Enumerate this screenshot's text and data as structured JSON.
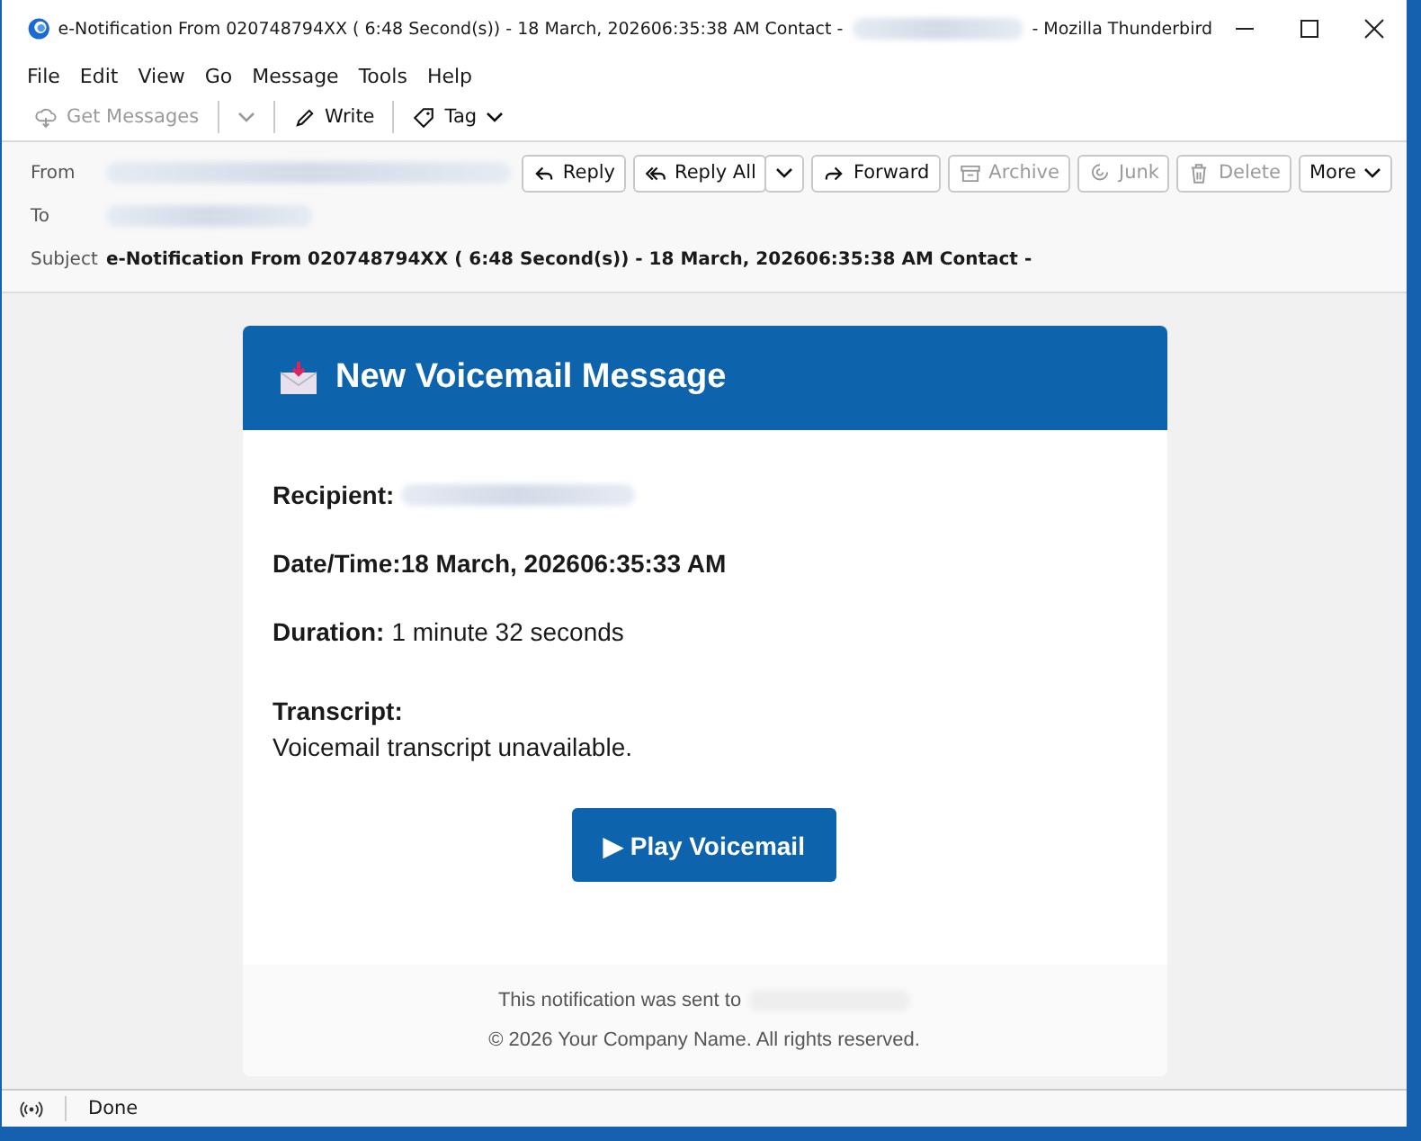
{
  "window": {
    "title_start": "e-Notification From 020748794XX ( 6:48 Second(s)) - 18 March, 202606:35:38 AM Contact -",
    "title_end": "- Mozilla Thunderbird"
  },
  "menu": [
    "File",
    "Edit",
    "View",
    "Go",
    "Message",
    "Tools",
    "Help"
  ],
  "toolbar": [
    {
      "kind": "get",
      "label": "Get Messages",
      "disabled": true
    },
    {
      "kind": "write",
      "label": "Write",
      "disabled": false
    },
    {
      "kind": "tag",
      "label": "Tag",
      "disabled": false
    }
  ],
  "header_buttons": [
    {
      "kind": "reply",
      "label": "Reply",
      "disabled": false
    },
    {
      "kind": "replyall",
      "label": "Reply All",
      "disabled": false
    },
    {
      "kind": "forward",
      "label": "Forward",
      "disabled": false
    },
    {
      "kind": "archive",
      "label": "Archive",
      "disabled": true
    },
    {
      "kind": "junk",
      "label": "Junk",
      "disabled": true
    },
    {
      "kind": "delete",
      "label": "Delete",
      "disabled": true
    },
    {
      "kind": "more",
      "label": "More",
      "disabled": false
    }
  ],
  "fields": [
    {
      "label": "From"
    },
    {
      "label": "To"
    },
    {
      "label": "Subject",
      "value": "e-Notification From 020748794XX ( 6:48 Second(s)) - 18 March, 202606:35:38 AM Contact -"
    }
  ],
  "email": {
    "heading": "New Voicemail Message",
    "recipient_label": "Recipient:",
    "datetime_label": "Date/Time:",
    "datetime": "18 March, 202606:35:33 AM",
    "duration_label": "Duration:",
    "duration": "1 minute 32 seconds",
    "transcript_label": "Transcript:",
    "transcript": "Voicemail transcript unavailable.",
    "button": "▶ Play Voicemail",
    "footer_sent": "This notification was sent to",
    "footer_copyright": "© 2026 Your Company Name. All rights reserved."
  },
  "status_bar": {
    "text": "Done"
  }
}
